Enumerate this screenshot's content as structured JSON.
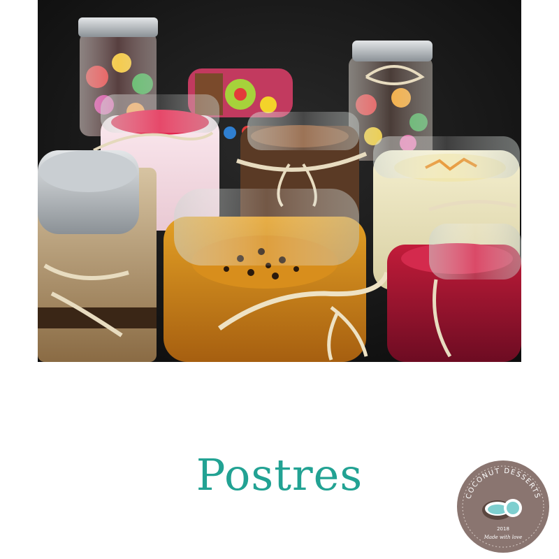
{
  "photo": {
    "description_icon": "dessert-jars-photo"
  },
  "title": "Postres",
  "logo": {
    "brand_top": "COCONUT DESSERTS",
    "year": "2018",
    "tagline": "Made with love"
  },
  "colors": {
    "title": "#22a293",
    "logo_bg": "#8a7570",
    "logo_coconut": "#7ecfcf",
    "photo_bg": "#161616"
  }
}
